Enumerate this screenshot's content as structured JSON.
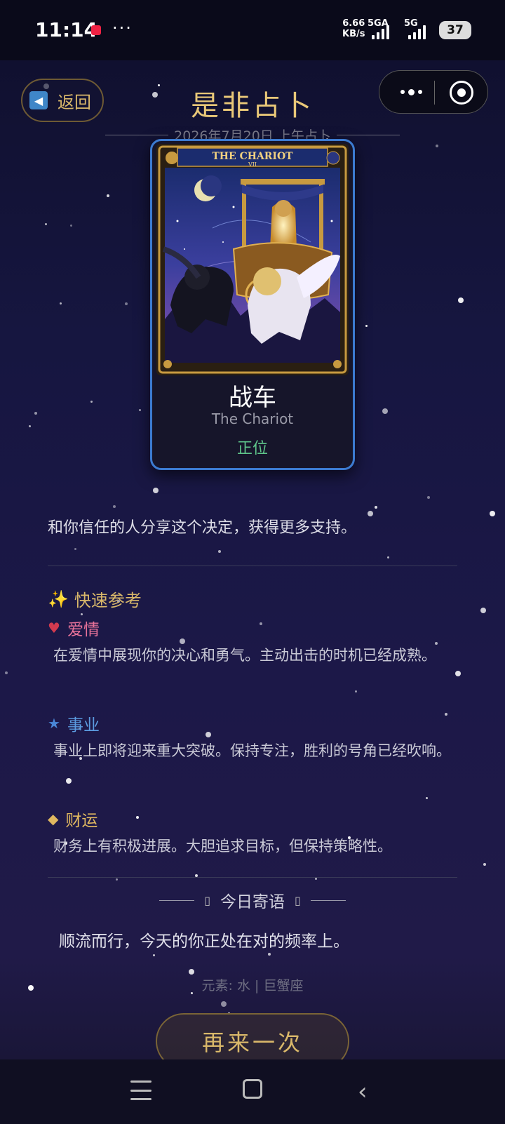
{
  "status_bar": {
    "time": "11:14",
    "more": "···",
    "speed_value": "6.66",
    "speed_unit": "KB/s",
    "network_1": "5GA",
    "network_2": "5G",
    "battery": "37"
  },
  "header": {
    "back_label": "返回",
    "title": "是非占卜",
    "subtitle": "2026年7月20日 上午占卜"
  },
  "card": {
    "art_title": "THE CHARIOT",
    "art_number": "VII",
    "name": "战车",
    "english_name": "The Chariot",
    "position": "正位"
  },
  "advice": "和你信任的人分享这个决定，获得更多支持。",
  "quick_reference": {
    "heading": "快速参考",
    "heading_icon": "✨",
    "categories": [
      {
        "icon": "♥",
        "label": "爱情",
        "color": "#e8739a",
        "icon_color": "#d23a4f",
        "text": "在爱情中展现你的决心和勇气。主动出击的时机已经成熟。"
      },
      {
        "icon": "★",
        "label": "事业",
        "color": "#5b9be0",
        "icon_color": "#4a86d6",
        "text": "事业上即将迎来重大突破。保持专注，胜利的号角已经吹响。"
      },
      {
        "icon": "◆",
        "label": "财运",
        "color": "#e0b860",
        "icon_color": "#e0b860",
        "text": "财务上有积极进展。大胆追求目标，但保持策略性。"
      }
    ]
  },
  "daily_message": {
    "heading": "今日寄语",
    "bracket_left": "▯",
    "bracket_right": "▯",
    "text": "顺流而行，今天的你正处在对的频率上。"
  },
  "meta": "元素: 水 | 巨蟹座",
  "retry_button": "再来一次",
  "colors": {
    "gold": "#d9b86a",
    "card_border": "#3c7bd1",
    "upright_green": "#5ec48a"
  }
}
